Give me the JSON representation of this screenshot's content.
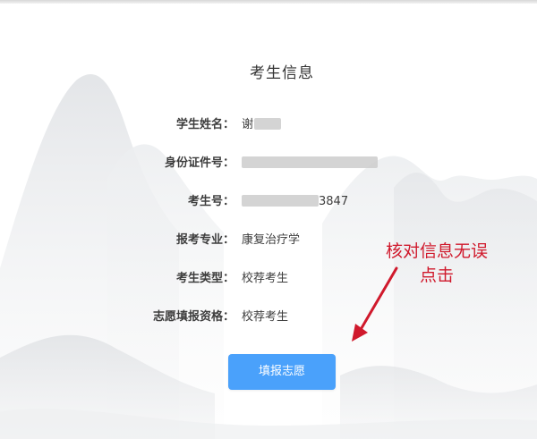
{
  "page": {
    "title": "考生信息"
  },
  "fields": [
    {
      "label": "学生姓名：",
      "value": "谢"
    },
    {
      "label": "身份证件号：",
      "value": ""
    },
    {
      "label": "考生号：",
      "value": "3847"
    },
    {
      "label": "报考专业：",
      "value": "康复治疗学"
    },
    {
      "label": "考生类型：",
      "value": "校荐考生"
    },
    {
      "label": "志愿填报资格：",
      "value": "校荐考生"
    }
  ],
  "actions": {
    "submit_label": "填报志愿",
    "primary_color": "#4aa1fb"
  },
  "annotation": {
    "line1": "核对信息无误",
    "line2": "点击",
    "color": "#d0192c"
  }
}
